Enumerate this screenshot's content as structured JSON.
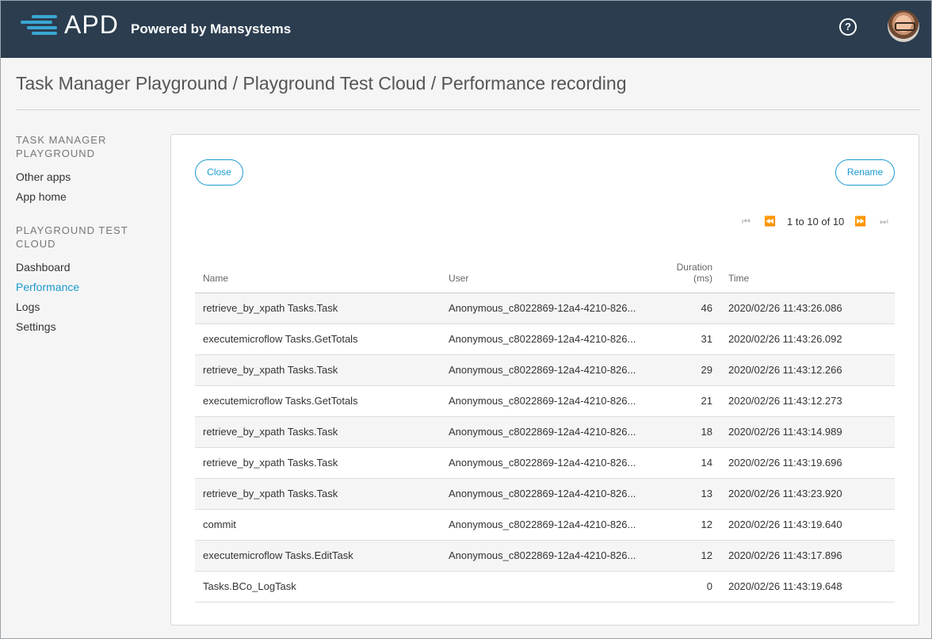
{
  "header": {
    "logo_text": "APD",
    "subtitle": "Powered by Mansystems",
    "help_label": "?"
  },
  "breadcrumb": "Task Manager Playground / Playground Test Cloud / Performance recording",
  "sidebar": {
    "section1_title": "TASK MANAGER PLAYGROUND",
    "section1_items": [
      {
        "label": "Other apps"
      },
      {
        "label": "App home"
      }
    ],
    "section2_title": "PLAYGROUND TEST CLOUD",
    "section2_items": [
      {
        "label": "Dashboard"
      },
      {
        "label": "Performance"
      },
      {
        "label": "Logs"
      },
      {
        "label": "Settings"
      }
    ]
  },
  "actions": {
    "close_label": "Close",
    "rename_label": "Rename"
  },
  "pager": {
    "text": "1 to 10 of 10"
  },
  "table": {
    "columns": {
      "name": "Name",
      "user": "User",
      "duration_line1": "Duration",
      "duration_line2": "(ms)",
      "time": "Time"
    },
    "rows": [
      {
        "name": "retrieve_by_xpath Tasks.Task",
        "user": "Anonymous_c8022869-12a4-4210-826...",
        "duration": "46",
        "time": "2020/02/26 11:43:26.086"
      },
      {
        "name": "executemicroflow Tasks.GetTotals",
        "user": "Anonymous_c8022869-12a4-4210-826...",
        "duration": "31",
        "time": "2020/02/26 11:43:26.092"
      },
      {
        "name": "retrieve_by_xpath Tasks.Task",
        "user": "Anonymous_c8022869-12a4-4210-826...",
        "duration": "29",
        "time": "2020/02/26 11:43:12.266"
      },
      {
        "name": "executemicroflow Tasks.GetTotals",
        "user": "Anonymous_c8022869-12a4-4210-826...",
        "duration": "21",
        "time": "2020/02/26 11:43:12.273"
      },
      {
        "name": "retrieve_by_xpath Tasks.Task",
        "user": "Anonymous_c8022869-12a4-4210-826...",
        "duration": "18",
        "time": "2020/02/26 11:43:14.989"
      },
      {
        "name": "retrieve_by_xpath Tasks.Task",
        "user": "Anonymous_c8022869-12a4-4210-826...",
        "duration": "14",
        "time": "2020/02/26 11:43:19.696"
      },
      {
        "name": "retrieve_by_xpath Tasks.Task",
        "user": "Anonymous_c8022869-12a4-4210-826...",
        "duration": "13",
        "time": "2020/02/26 11:43:23.920"
      },
      {
        "name": "commit",
        "user": "Anonymous_c8022869-12a4-4210-826...",
        "duration": "12",
        "time": "2020/02/26 11:43:19.640"
      },
      {
        "name": "executemicroflow Tasks.EditTask",
        "user": "Anonymous_c8022869-12a4-4210-826...",
        "duration": "12",
        "time": "2020/02/26 11:43:17.896"
      },
      {
        "name": "Tasks.BCo_LogTask",
        "user": "",
        "duration": "0",
        "time": "2020/02/26 11:43:19.648"
      }
    ]
  },
  "colors": {
    "header_bg": "#2b3d4f",
    "accent": "#1a9ad2",
    "logo_accent": "#3aa7d4"
  },
  "icons": {
    "help": "help-circle-icon",
    "avatar": "user-avatar",
    "first_page": "first-page-icon",
    "prev_page": "previous-page-icon",
    "next_page": "next-page-icon",
    "last_page": "last-page-icon"
  }
}
